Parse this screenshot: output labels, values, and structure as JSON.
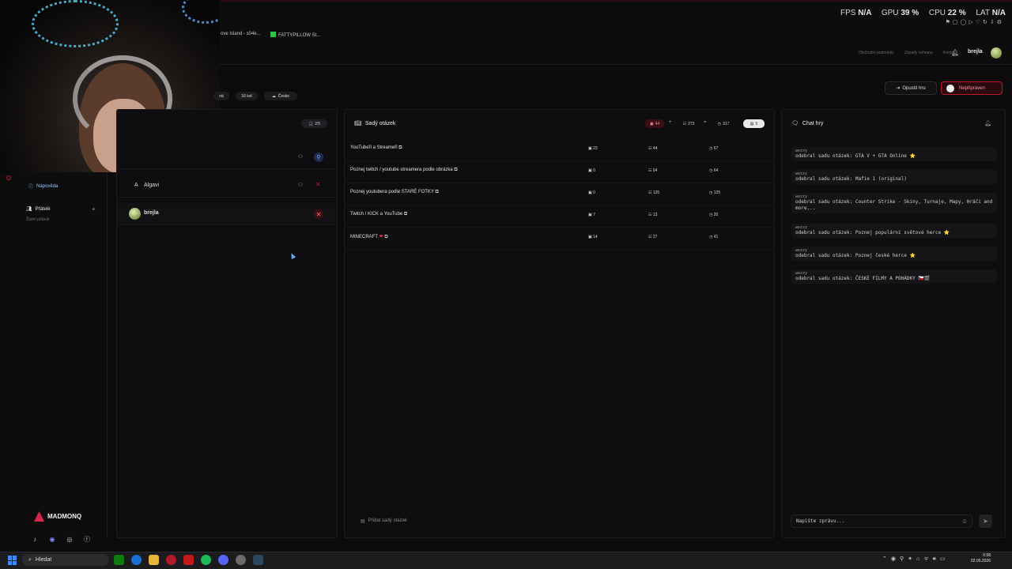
{
  "overlay": {
    "fps_label": "FPS",
    "fps_value": "N/A",
    "gpu_label": "GPU",
    "gpu_value": "39 %",
    "cpu_label": "CPU",
    "cpu_value": "22 %",
    "lat_label": "LAT",
    "lat_value": "N/A"
  },
  "bookmarks": [
    "ove Island - s04e...",
    "FATTYPILLOW St..."
  ],
  "site_links": [
    "Obchodní podmínky",
    "Zásady ochrany",
    "Kontakt"
  ],
  "user": {
    "name": "brejla"
  },
  "game_controls": {
    "leave_label": "Opustit hru",
    "not_ready_label": "Nepřipraven"
  },
  "chips": [
    "ná",
    "16 kol",
    "Česko"
  ],
  "left_nav": {
    "help_label": "Nápověda",
    "friends_label": "Přátelé",
    "no_friends_label": "Žádní přátelé",
    "brand": "MADMONQ"
  },
  "players": {
    "count_label": "2/5",
    "rows": [
      {
        "name": "Algavi"
      },
      {
        "name": "brejla"
      }
    ]
  },
  "question_sets": {
    "title": "Sadý otázek",
    "summary": {
      "a": "44",
      "b": "273",
      "c": "317",
      "d": "5"
    },
    "rows": [
      {
        "name": "YouTubeři a Streameři",
        "a": "23",
        "b": "44",
        "c": "67"
      },
      {
        "name": "Poznej twitch / youtube streamera podle obrázka",
        "a": "0",
        "b": "64",
        "c": "64"
      },
      {
        "name": "Poznej youtubera podle STARÉ FOTKY",
        "a": "0",
        "b": "125",
        "c": "125"
      },
      {
        "name": "Twitch / KICK a YouTube",
        "a": "7",
        "b": "13",
        "c": "20"
      },
      {
        "name": "MINECRAFT",
        "a": "14",
        "b": "27",
        "c": "41"
      }
    ],
    "add_label": "Přidat sadý otázek"
  },
  "chat": {
    "title": "Chat hry",
    "messages": [
      {
        "author": "wezzy",
        "text": "odebral sadu otázek: GTA V + GTA Online ⭐"
      },
      {
        "author": "wezzy",
        "text": "odebral sadu otázek: Mafie 1 (original)"
      },
      {
        "author": "wezzy",
        "text": "odebral sadu otázek: Counter Strike - Skiny, Turnaje, Mapy, Hráči and more..."
      },
      {
        "author": "wezzy",
        "text": "odebral sadu otázek: Poznej populární světové herce ⭐"
      },
      {
        "author": "wezzy",
        "text": "odebral sadu otázek: Poznej české herce ⭐"
      },
      {
        "author": "wezzy",
        "text": "odebral sadu otázek: ČESKÉ FILMY A POHÁDKY 🇨🇿🎬"
      }
    ],
    "input_placeholder": "Napište zprávu..."
  },
  "taskbar": {
    "search_label": "Hledat",
    "time": "0:58",
    "date": "02.05.2026"
  },
  "colors": {
    "accent_red": "#c0182b",
    "background": "#0b0b0c",
    "panel": "#0e0e10"
  }
}
